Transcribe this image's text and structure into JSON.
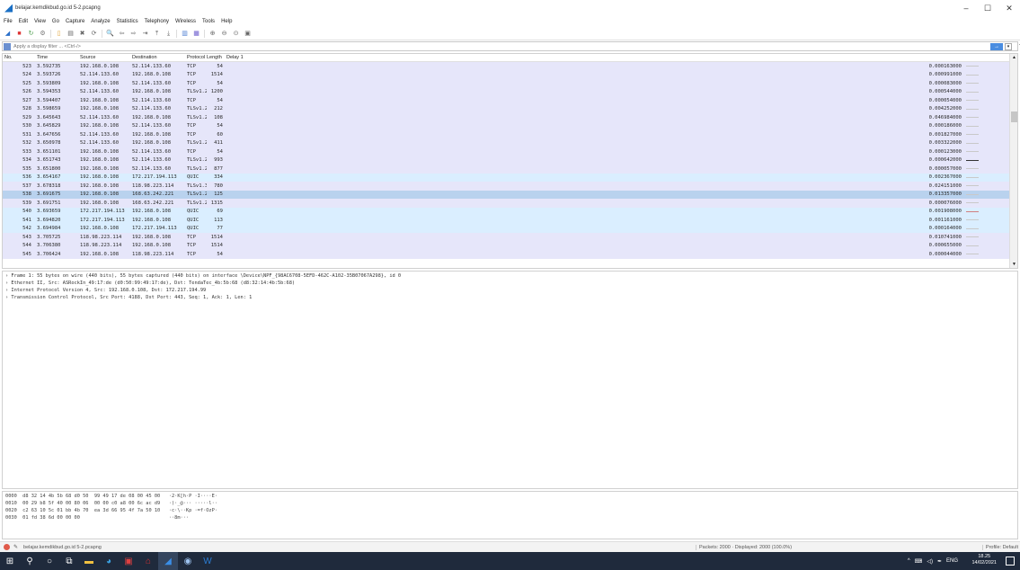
{
  "window": {
    "title": "belajar.kemdikbud.go.id 5-2.pcapng",
    "minimize": "–",
    "maximize": "☐",
    "close": "✕"
  },
  "menu": [
    "File",
    "Edit",
    "View",
    "Go",
    "Capture",
    "Analyze",
    "Statistics",
    "Telephony",
    "Wireless",
    "Tools",
    "Help"
  ],
  "toolbar_icons": [
    {
      "name": "start-capture-icon",
      "glyph": "◢",
      "color": "#2a6fc9"
    },
    {
      "name": "stop-capture-icon",
      "glyph": "■",
      "color": "#d33"
    },
    {
      "name": "restart-capture-icon",
      "glyph": "↻",
      "color": "#4c9e4c"
    },
    {
      "name": "capture-options-icon",
      "glyph": "⚙",
      "color": "#777"
    },
    {
      "name": "open-file-icon",
      "glyph": "▯",
      "color": "#e0a030"
    },
    {
      "name": "save-file-icon",
      "glyph": "▤",
      "color": "#666"
    },
    {
      "name": "close-file-icon",
      "glyph": "✖",
      "color": "#666"
    },
    {
      "name": "reload-file-icon",
      "glyph": "⟳",
      "color": "#666"
    },
    {
      "name": "find-packet-icon",
      "glyph": "🔍",
      "color": "#666"
    },
    {
      "name": "go-back-icon",
      "glyph": "⇦",
      "color": "#666"
    },
    {
      "name": "go-forward-icon",
      "glyph": "⇨",
      "color": "#666"
    },
    {
      "name": "go-to-packet-icon",
      "glyph": "⇥",
      "color": "#666"
    },
    {
      "name": "first-packet-icon",
      "glyph": "⤒",
      "color": "#666"
    },
    {
      "name": "last-packet-icon",
      "glyph": "⤓",
      "color": "#666"
    },
    {
      "name": "autoscroll-icon",
      "glyph": "▥",
      "color": "#4a7bd0"
    },
    {
      "name": "colorize-icon",
      "glyph": "▦",
      "color": "#6a5acd"
    },
    {
      "name": "zoom-in-icon",
      "glyph": "⊕",
      "color": "#666"
    },
    {
      "name": "zoom-out-icon",
      "glyph": "⊖",
      "color": "#666"
    },
    {
      "name": "zoom-normal-icon",
      "glyph": "⊙",
      "color": "#666"
    },
    {
      "name": "resize-columns-icon",
      "glyph": "▣",
      "color": "#666"
    }
  ],
  "filter": {
    "placeholder": "Apply a display filter ... <Ctrl-/>",
    "apply_label": "→",
    "dropdown_label": "▾",
    "add_label": "+"
  },
  "packet_list": {
    "columns": [
      "No.",
      "Time",
      "Source",
      "Destination",
      "Protocol",
      "Length",
      "Delay 1"
    ],
    "rows": [
      {
        "no": "523",
        "time": "3.592735",
        "src": "192.168.0.108",
        "dst": "52.114.133.60",
        "proto": "TCP",
        "len": "54",
        "delay": "0.000163000",
        "cls": "tcp",
        "mark": ""
      },
      {
        "no": "524",
        "time": "3.593726",
        "src": "52.114.133.60",
        "dst": "192.168.0.108",
        "proto": "TCP",
        "len": "1514",
        "delay": "0.000991000",
        "cls": "tcp",
        "mark": ""
      },
      {
        "no": "525",
        "time": "3.593809",
        "src": "192.168.0.108",
        "dst": "52.114.133.60",
        "proto": "TCP",
        "len": "54",
        "delay": "0.000083000",
        "cls": "tcp",
        "mark": ""
      },
      {
        "no": "526",
        "time": "3.594353",
        "src": "52.114.133.60",
        "dst": "192.168.0.108",
        "proto": "TLSv1.2",
        "len": "1200",
        "delay": "0.000544000",
        "cls": "tls",
        "mark": ""
      },
      {
        "no": "527",
        "time": "3.594407",
        "src": "192.168.0.108",
        "dst": "52.114.133.60",
        "proto": "TCP",
        "len": "54",
        "delay": "0.000054000",
        "cls": "tcp",
        "mark": ""
      },
      {
        "no": "528",
        "time": "3.598659",
        "src": "192.168.0.108",
        "dst": "52.114.133.60",
        "proto": "TLSv1.2",
        "len": "212",
        "delay": "0.004252000",
        "cls": "tls",
        "mark": ""
      },
      {
        "no": "529",
        "time": "3.645643",
        "src": "52.114.133.60",
        "dst": "192.168.0.108",
        "proto": "TLSv1.2",
        "len": "108",
        "delay": "0.046984000",
        "cls": "tls",
        "mark": ""
      },
      {
        "no": "530",
        "time": "3.645829",
        "src": "192.168.0.108",
        "dst": "52.114.133.60",
        "proto": "TCP",
        "len": "54",
        "delay": "0.000186000",
        "cls": "tcp",
        "mark": ""
      },
      {
        "no": "531",
        "time": "3.647656",
        "src": "52.114.133.60",
        "dst": "192.168.0.108",
        "proto": "TCP",
        "len": "60",
        "delay": "0.001827000",
        "cls": "tcp",
        "mark": ""
      },
      {
        "no": "532",
        "time": "3.650978",
        "src": "52.114.133.60",
        "dst": "192.168.0.108",
        "proto": "TLSv1.2",
        "len": "411",
        "delay": "0.003322000",
        "cls": "tls",
        "mark": ""
      },
      {
        "no": "533",
        "time": "3.651101",
        "src": "192.168.0.108",
        "dst": "52.114.133.60",
        "proto": "TCP",
        "len": "54",
        "delay": "0.000123000",
        "cls": "tcp",
        "mark": ""
      },
      {
        "no": "534",
        "time": "3.651743",
        "src": "192.168.0.108",
        "dst": "52.114.133.60",
        "proto": "TLSv1.2",
        "len": "993",
        "delay": "0.000642000",
        "cls": "tls",
        "mark": "dark"
      },
      {
        "no": "535",
        "time": "3.651800",
        "src": "192.168.0.108",
        "dst": "52.114.133.60",
        "proto": "TLSv1.2",
        "len": "877",
        "delay": "0.000057000",
        "cls": "tls",
        "mark": ""
      },
      {
        "no": "536",
        "time": "3.654167",
        "src": "192.168.0.108",
        "dst": "172.217.194.113",
        "proto": "QUIC",
        "len": "334",
        "delay": "0.002367000",
        "cls": "quic",
        "mark": ""
      },
      {
        "no": "537",
        "time": "3.678318",
        "src": "192.168.0.108",
        "dst": "118.98.223.114",
        "proto": "TLSv1.3",
        "len": "780",
        "delay": "0.024151000",
        "cls": "tls",
        "mark": ""
      },
      {
        "no": "538",
        "time": "3.691675",
        "src": "192.168.0.108",
        "dst": "168.63.242.221",
        "proto": "TLSv1.2",
        "len": "125",
        "delay": "0.013357000",
        "cls": "sel",
        "mark": ""
      },
      {
        "no": "539",
        "time": "3.691751",
        "src": "192.168.0.108",
        "dst": "168.63.242.221",
        "proto": "TLSv1.2",
        "len": "1315",
        "delay": "0.000076000",
        "cls": "tls",
        "mark": ""
      },
      {
        "no": "540",
        "time": "3.693659",
        "src": "172.217.194.113",
        "dst": "192.168.0.108",
        "proto": "QUIC",
        "len": "69",
        "delay": "0.001908000",
        "cls": "quic",
        "mark": "red"
      },
      {
        "no": "541",
        "time": "3.694820",
        "src": "172.217.194.113",
        "dst": "192.168.0.108",
        "proto": "QUIC",
        "len": "113",
        "delay": "0.001161000",
        "cls": "quic",
        "mark": ""
      },
      {
        "no": "542",
        "time": "3.694984",
        "src": "192.168.0.108",
        "dst": "172.217.194.113",
        "proto": "QUIC",
        "len": "77",
        "delay": "0.000164000",
        "cls": "quic",
        "mark": ""
      },
      {
        "no": "543",
        "time": "3.705725",
        "src": "118.98.223.114",
        "dst": "192.168.0.108",
        "proto": "TCP",
        "len": "1514",
        "delay": "0.010741000",
        "cls": "tcp",
        "mark": ""
      },
      {
        "no": "544",
        "time": "3.706380",
        "src": "118.98.223.114",
        "dst": "192.168.0.108",
        "proto": "TCP",
        "len": "1514",
        "delay": "0.000655000",
        "cls": "tcp",
        "mark": ""
      },
      {
        "no": "545",
        "time": "3.706424",
        "src": "192.168.0.108",
        "dst": "118.98.223.114",
        "proto": "TCP",
        "len": "54",
        "delay": "0.000044000",
        "cls": "tcp",
        "mark": ""
      }
    ]
  },
  "details": [
    "Frame 1: 55 bytes on wire (440 bits), 55 bytes captured (440 bits) on interface \\Device\\NPF_{98AC6708-5EFD-462C-A102-35B07067A298}, id 0",
    "Ethernet II, Src: ASRockIn_49:17:de (d0:50:99:49:17:de), Dst: TendaTec_4b:5b:68 (d8:32:14:4b:5b:68)",
    "Internet Protocol Version 4, Src: 192.168.0.108, Dst: 172.217.194.99",
    "Transmission Control Protocol, Src Port: 4188, Dst Port: 443, Seq: 1, Ack: 1, Len: 1"
  ],
  "hex": [
    "0000  d8 32 14 4b 5b 68 d0 50  99 49 17 de 08 00 45 00   ·2·K[h·P ·I····E·",
    "0010  00 29 b8 5f 40 00 80 06  00 00 c0 a8 00 6c ac d9   ·)·_@··· ·····l··",
    "0020  c2 63 10 5c 01 bb 4b 70  ea 3d 66 95 4f 7a 50 10   ·c·\\··Kp ·=f·OzP·",
    "0030  01 fd 38 6d 00 00 00                               ··8m···"
  ],
  "status": {
    "file": "belajar.kemdikbud.go.id 5-2.pcapng",
    "packets": "Packets: 2000 · Displayed: 2000 (100.0%)",
    "profile": "Profile: Default"
  },
  "taskbar": {
    "lang": "ENG",
    "time": "18.25",
    "date": "14/02/2021"
  }
}
